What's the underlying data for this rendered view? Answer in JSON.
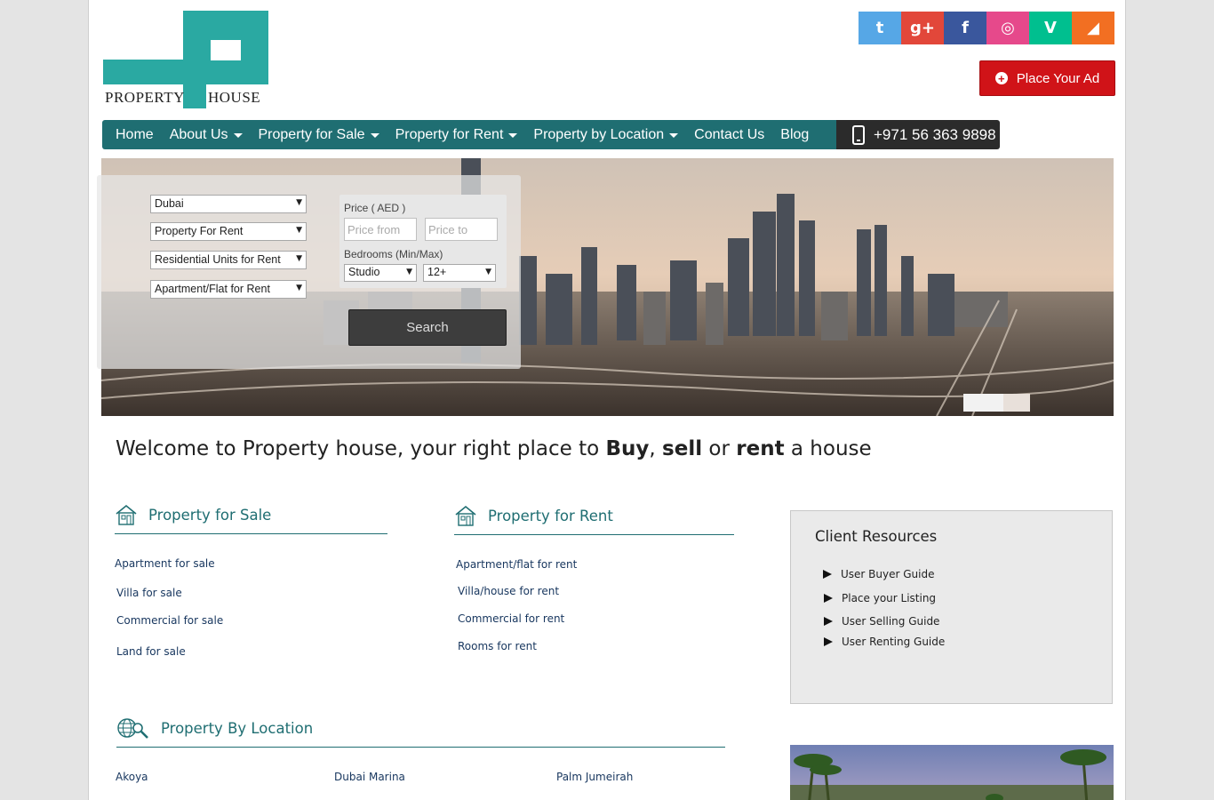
{
  "logo": {
    "word1": "PROPERTY",
    "word2": "HOUSE"
  },
  "social": [
    {
      "name": "twitter",
      "glyph": "t",
      "color": "#56a7e6"
    },
    {
      "name": "google-plus",
      "glyph": "g+",
      "color": "#e2473a"
    },
    {
      "name": "facebook",
      "glyph": "f",
      "color": "#3a579d"
    },
    {
      "name": "dribbble",
      "glyph": "◎",
      "color": "#e6498b"
    },
    {
      "name": "vine",
      "glyph": "V",
      "color": "#00bf8f"
    },
    {
      "name": "rss",
      "glyph": "◢",
      "color": "#f26f22"
    }
  ],
  "place_ad": {
    "label": "Place Your Ad"
  },
  "nav": {
    "items": [
      {
        "label": "Home",
        "dropdown": false
      },
      {
        "label": "About Us",
        "dropdown": true
      },
      {
        "label": "Property for Sale",
        "dropdown": true
      },
      {
        "label": "Property for Rent",
        "dropdown": true
      },
      {
        "label": "Property by Location",
        "dropdown": true
      },
      {
        "label": "Contact Us",
        "dropdown": false
      },
      {
        "label": "Blog",
        "dropdown": false
      }
    ],
    "phone": "+971 56 363 9898"
  },
  "search": {
    "city": "Dubai",
    "purpose": "Property For Rent",
    "category": "Residential Units for Rent",
    "type": "Apartment/Flat for Rent",
    "price_label": "Price ( AED )",
    "price_from_placeholder": "Price from",
    "price_to_placeholder": "Price to",
    "bedrooms_label": "Bedrooms (Min/Max)",
    "bed_min": "Studio",
    "bed_max": "12+",
    "button": "Search"
  },
  "welcome": {
    "prefix": "Welcome to Property house, your right place to ",
    "buy": "Buy",
    "comma": ", ",
    "sell": "sell",
    "or": " or ",
    "rent": "rent",
    "suffix": " a house"
  },
  "sale": {
    "title": "Property for Sale",
    "links": [
      "Apartment for sale",
      "Villa for sale",
      "Commercial for sale",
      "Land for sale"
    ]
  },
  "rent": {
    "title": "Property for Rent",
    "links": [
      "Apartment/flat for rent",
      "Villa/house for rent",
      "Commercial for rent",
      "Rooms for rent"
    ]
  },
  "resources": {
    "title": "Client Resources",
    "items": [
      "User Buyer Guide",
      "Place your Listing",
      "User Selling Guide",
      "User Renting Guide"
    ]
  },
  "location": {
    "title": "Property By Location",
    "links": [
      "Akoya",
      "Dubai Marina",
      "Palm Jumeirah"
    ]
  },
  "colors": {
    "teal": "#1f6e72",
    "logo_teal": "#2aa9a2",
    "ad_red": "#d01318"
  }
}
